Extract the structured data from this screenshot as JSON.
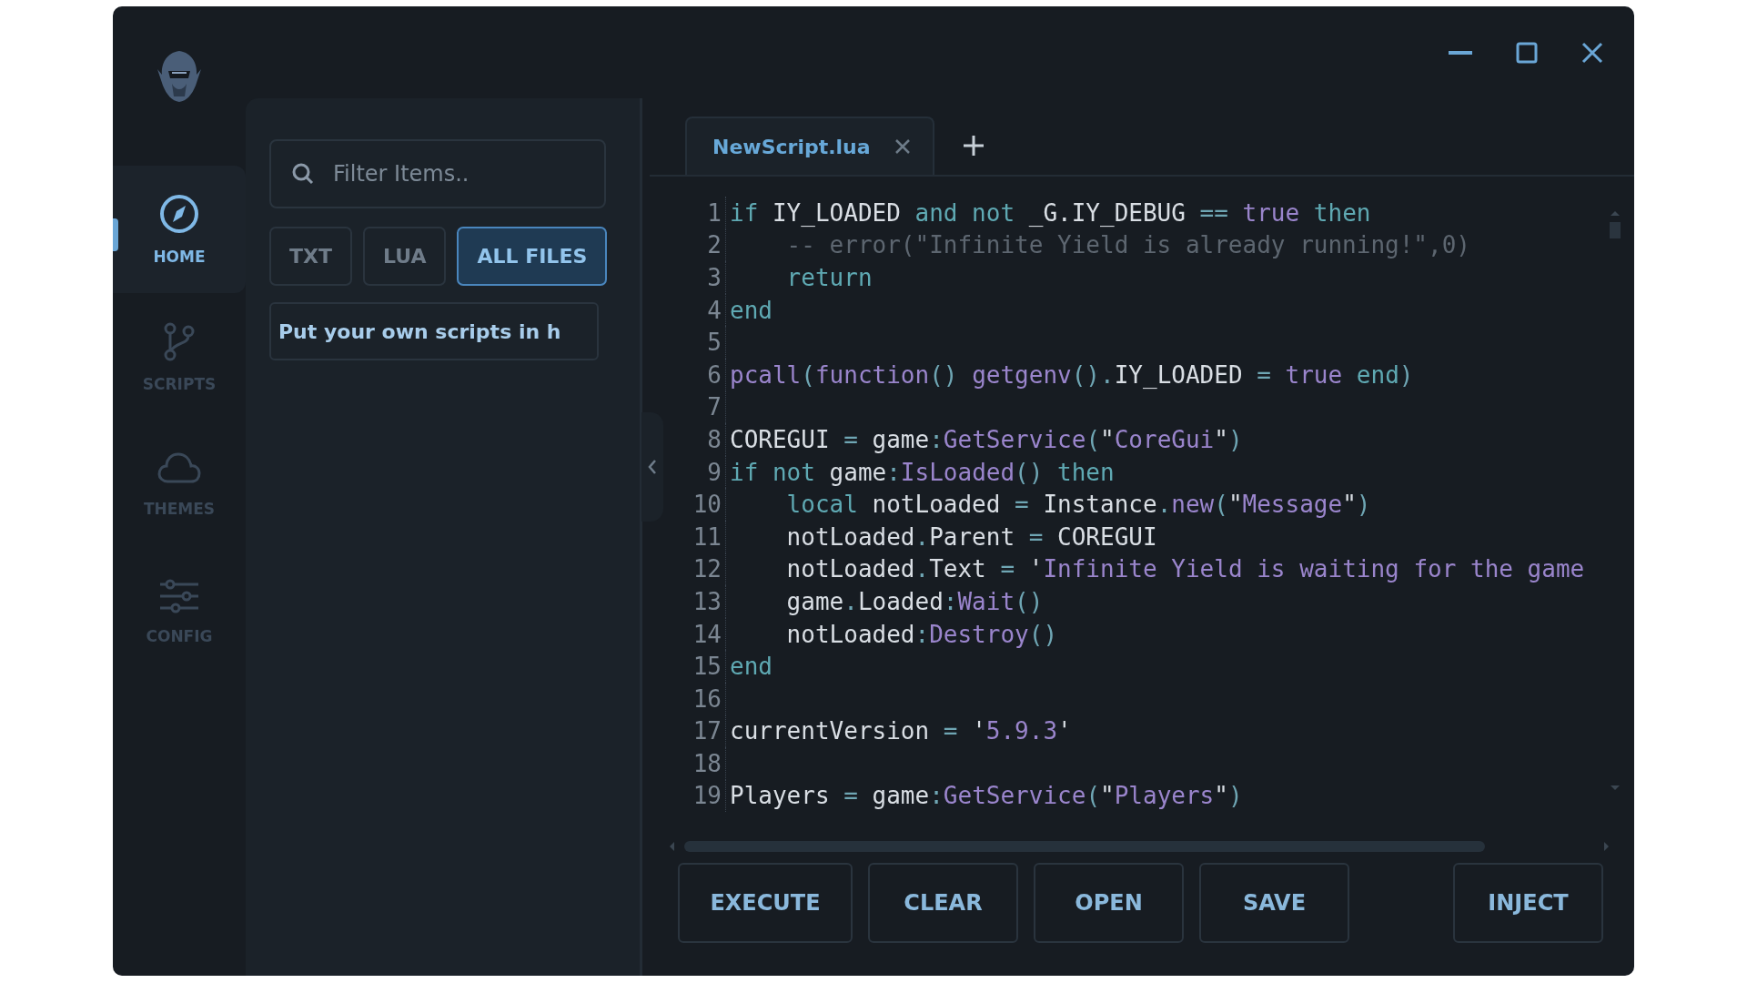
{
  "sidebar": {
    "items": [
      {
        "label": "HOME",
        "selected": true
      },
      {
        "label": "SCRIPTS",
        "selected": false
      },
      {
        "label": "THEMES",
        "selected": false
      },
      {
        "label": "CONFIG",
        "selected": false
      }
    ]
  },
  "file_panel": {
    "search": {
      "placeholder": "Filter Items.."
    },
    "filters": [
      {
        "label": "TXT",
        "selected": false
      },
      {
        "label": "LUA",
        "selected": false
      },
      {
        "label": "ALL FILES",
        "selected": true
      }
    ],
    "scripts": [
      "Put your own scripts in h"
    ]
  },
  "tabs": [
    {
      "label": "NewScript.lua",
      "selected": true
    }
  ],
  "editor": {
    "lines": [
      {
        "number": "1",
        "tokens": [
          {
            "kind": "keyword",
            "text": "if"
          },
          {
            "kind": "plain",
            "text": " IY_LOADED "
          },
          {
            "kind": "keyword",
            "text": "and not"
          },
          {
            "kind": "plain",
            "text": " _G.IY_DEBUG "
          },
          {
            "kind": "punct",
            "text": "=="
          },
          {
            "kind": "literal",
            "text": " true"
          },
          {
            "kind": "keyword",
            "text": " then"
          }
        ]
      },
      {
        "number": "2",
        "tokens": [
          {
            "kind": "comment",
            "text": "    -- error(\"Infinite Yield is already running!\",0)"
          }
        ]
      },
      {
        "number": "3",
        "tokens": [
          {
            "kind": "keyword",
            "text": "    return"
          }
        ]
      },
      {
        "number": "4",
        "tokens": [
          {
            "kind": "keyword",
            "text": "end"
          }
        ]
      },
      {
        "number": "5"
      },
      {
        "number": "6",
        "tokens": [
          {
            "kind": "method",
            "text": "pcall"
          },
          {
            "kind": "punct",
            "text": "("
          },
          {
            "kind": "method",
            "text": "function"
          },
          {
            "kind": "punct",
            "text": "() "
          },
          {
            "kind": "method",
            "text": "getgenv"
          },
          {
            "kind": "punct",
            "text": "()."
          },
          {
            "kind": "plain",
            "text": "IY_LOADED "
          },
          {
            "kind": "punct",
            "text": "= "
          },
          {
            "kind": "literal",
            "text": "true"
          },
          {
            "kind": "keyword",
            "text": " end"
          },
          {
            "kind": "punct",
            "text": ")"
          }
        ]
      },
      {
        "number": "7"
      },
      {
        "number": "8",
        "tokens": [
          {
            "kind": "plain",
            "text": "COREGUI "
          },
          {
            "kind": "punct",
            "text": "= "
          },
          {
            "kind": "plain",
            "text": "game"
          },
          {
            "kind": "punct",
            "text": ":"
          },
          {
            "kind": "method",
            "text": "GetService"
          },
          {
            "kind": "punct",
            "text": "("
          },
          {
            "kind": "plain",
            "text": "\""
          },
          {
            "kind": "string",
            "text": "CoreGui"
          },
          {
            "kind": "plain",
            "text": "\""
          },
          {
            "kind": "punct",
            "text": ")"
          }
        ]
      },
      {
        "number": "9",
        "tokens": [
          {
            "kind": "keyword",
            "text": "if not"
          },
          {
            "kind": "plain",
            "text": " game"
          },
          {
            "kind": "punct",
            "text": ":"
          },
          {
            "kind": "method",
            "text": "IsLoaded"
          },
          {
            "kind": "punct",
            "text": "()"
          },
          {
            "kind": "keyword",
            "text": " then"
          }
        ]
      },
      {
        "number": "10",
        "tokens": [
          {
            "kind": "keyword",
            "text": "    local"
          },
          {
            "kind": "plain",
            "text": " notLoaded "
          },
          {
            "kind": "punct",
            "text": "= "
          },
          {
            "kind": "plain",
            "text": "Instance"
          },
          {
            "kind": "punct",
            "text": "."
          },
          {
            "kind": "method",
            "text": "new"
          },
          {
            "kind": "punct",
            "text": "("
          },
          {
            "kind": "plain",
            "text": "\""
          },
          {
            "kind": "string",
            "text": "Message"
          },
          {
            "kind": "plain",
            "text": "\""
          },
          {
            "kind": "punct",
            "text": ")"
          }
        ]
      },
      {
        "number": "11",
        "tokens": [
          {
            "kind": "plain",
            "text": "    notLoaded"
          },
          {
            "kind": "punct",
            "text": "."
          },
          {
            "kind": "plain",
            "text": "Parent "
          },
          {
            "kind": "punct",
            "text": "= "
          },
          {
            "kind": "plain",
            "text": "COREGUI"
          }
        ]
      },
      {
        "number": "12",
        "tokens": [
          {
            "kind": "plain",
            "text": "    notLoaded"
          },
          {
            "kind": "punct",
            "text": "."
          },
          {
            "kind": "plain",
            "text": "Text "
          },
          {
            "kind": "punct",
            "text": "= "
          },
          {
            "kind": "plain",
            "text": "'"
          },
          {
            "kind": "string",
            "text": "Infinite Yield is waiting for the game"
          }
        ]
      },
      {
        "number": "13",
        "tokens": [
          {
            "kind": "plain",
            "text": "    game"
          },
          {
            "kind": "punct",
            "text": "."
          },
          {
            "kind": "plain",
            "text": "Loaded"
          },
          {
            "kind": "punct",
            "text": ":"
          },
          {
            "kind": "method",
            "text": "Wait"
          },
          {
            "kind": "punct",
            "text": "()"
          }
        ]
      },
      {
        "number": "14",
        "tokens": [
          {
            "kind": "plain",
            "text": "    notLoaded"
          },
          {
            "kind": "punct",
            "text": ":"
          },
          {
            "kind": "method",
            "text": "Destroy"
          },
          {
            "kind": "punct",
            "text": "()"
          }
        ]
      },
      {
        "number": "15",
        "tokens": [
          {
            "kind": "keyword",
            "text": "end"
          }
        ]
      },
      {
        "number": "16"
      },
      {
        "number": "17",
        "tokens": [
          {
            "kind": "plain",
            "text": "currentVersion "
          },
          {
            "kind": "punct",
            "text": "= "
          },
          {
            "kind": "plain",
            "text": "'"
          },
          {
            "kind": "string",
            "text": "5.9.3"
          },
          {
            "kind": "plain",
            "text": "'"
          }
        ]
      },
      {
        "number": "18"
      },
      {
        "number": "19",
        "tokens": [
          {
            "kind": "plain",
            "text": "Players "
          },
          {
            "kind": "punct",
            "text": "= "
          },
          {
            "kind": "plain",
            "text": "game"
          },
          {
            "kind": "punct",
            "text": ":"
          },
          {
            "kind": "method",
            "text": "GetService"
          },
          {
            "kind": "punct",
            "text": "("
          },
          {
            "kind": "plain",
            "text": "\""
          },
          {
            "kind": "string",
            "text": "Players"
          },
          {
            "kind": "plain",
            "text": "\""
          },
          {
            "kind": "punct",
            "text": ")"
          }
        ]
      }
    ]
  },
  "actions": [
    {
      "label": "EXECUTE",
      "kind": "main"
    },
    {
      "label": "CLEAR",
      "kind": "main"
    },
    {
      "label": "OPEN",
      "kind": "main"
    },
    {
      "label": "SAVE",
      "kind": "main"
    },
    {
      "label": "INJECT",
      "kind": "end"
    }
  ]
}
